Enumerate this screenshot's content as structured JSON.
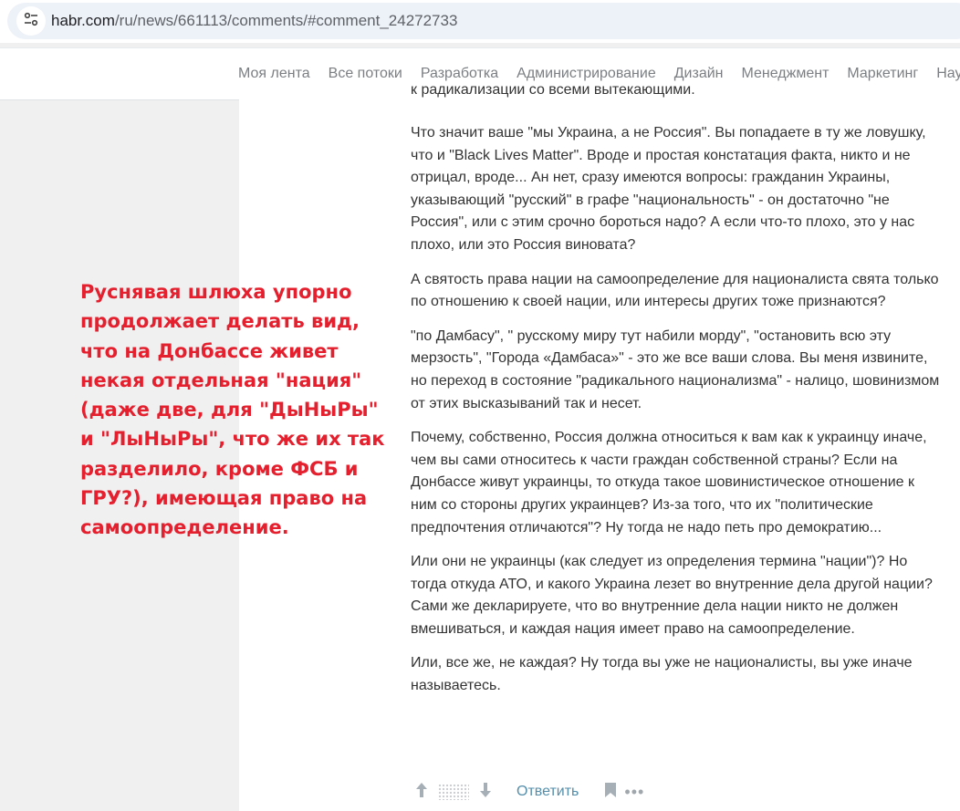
{
  "browser": {
    "url_host": "habr.com",
    "url_path": "/ru/news/661113/comments/#comment_24272733",
    "site_info_icon": "tune-icon"
  },
  "nav": {
    "items": [
      {
        "label": "Моя лента"
      },
      {
        "label": "Все потоки"
      },
      {
        "label": "Разработка"
      },
      {
        "label": "Администрирование"
      },
      {
        "label": "Дизайн"
      },
      {
        "label": "Менеджмент"
      },
      {
        "label": "Маркетинг"
      },
      {
        "label": "Науч"
      }
    ]
  },
  "comment": {
    "clipped_line": "к радикализации со всеми вытекающими.",
    "paragraphs": [
      "Что значит ваше \"мы Украина, а не Россия\". Вы попадаете в ту же ловушку, что и \"Black Lives Matter\". Вроде и простая констатация факта, никто и не отрицал, вроде... Ан нет, сразу имеются вопросы: гражданин Украины, указывающий \"русский\" в графе \"национальность\" - он достаточно \"не Россия\", или с этим срочно бороться надо? А если что-то плохо, это у нас плохо, или это Россия виновата?",
      "А святость права нации на самоопределение для националиста свята только по отношению к своей нации, или интересы других тоже признаются?",
      "\"по Дамбасу\", \" русскому миру тут набили морду\", \"остановить всю эту мерзость\", \"Города «Дамбаса»\" - это же все ваши слова. Вы меня извините, но переход в состояние \"радикального национализма\" - налицо, шовинизмом от этих высказываний так и несет.",
      "Почему, собственно, Россия должна относиться к вам как к украинцу иначе, чем вы сами относитесь к части граждан собственной страны? Если на Донбассе живут украинцы, то откуда такое шовинистическое отношение к ним со стороны других украинцев? Из-за того, что их \"политические предпочтения отличаются\"? Ну тогда не надо петь про демократию...",
      "Или они не украинцы (как следует из определения термина \"нации\")? Но тогда откуда АТО, и какого Украина лезет во внутренние дела другой нации? Сами же декларируете, что во внутренние дела нации никто не должен вмешиваться, и каждая нация имеет право на самоопределение.",
      "Или, все же, не каждая? Ну тогда вы уже не националисты, вы уже иначе называетесь."
    ],
    "footer": {
      "reply_label": "Ответить",
      "more_label": "•••"
    }
  },
  "overlay": {
    "text": "Руснявая шлюха упорно продолжает делать вид, что на Донбассе живет некая отдельная \"нация\" (даже две, для \"ДыНыРы\" и \"ЛыНыРы\", что же их так разделило, кроме ФСБ и ГРУ?), имеющая право на самоопределение.",
    "color": "#e5202e"
  },
  "colors": {
    "link": "#548eaa",
    "nav_text": "#7b7f83",
    "page_bg": "#f0f0f1"
  }
}
